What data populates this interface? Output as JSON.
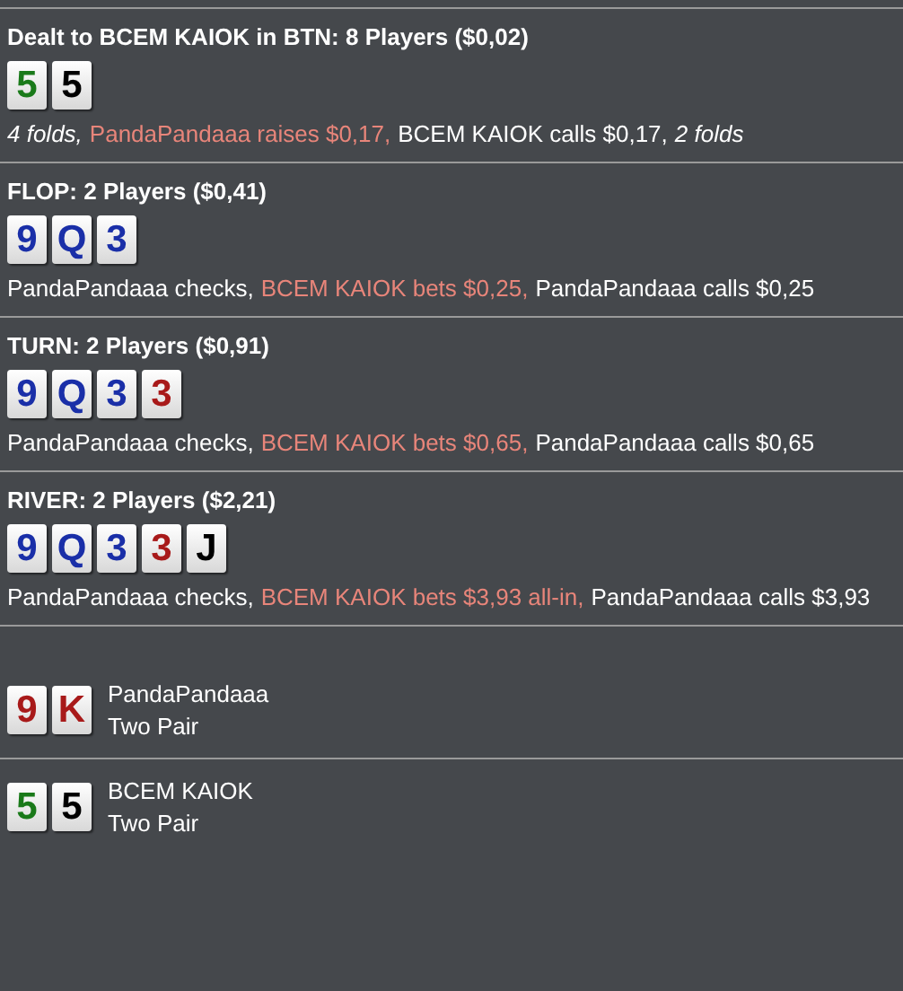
{
  "streets": [
    {
      "title": "Dealt to BCEM KAIOK in BTN: 8 Players ($0,02)",
      "cards": [
        {
          "rank": "5",
          "color": "#1a7a1a"
        },
        {
          "rank": "5",
          "color": "#000000"
        }
      ],
      "actions": [
        {
          "kind": "fold",
          "text": "4 folds,"
        },
        {
          "kind": "highlight",
          "text": "PandaPandaaa raises $0,17,"
        },
        {
          "kind": "plain",
          "text": "BCEM KAIOK calls $0,17,"
        },
        {
          "kind": "fold",
          "text": "2 folds"
        }
      ]
    },
    {
      "title": "FLOP: 2 Players ($0,41)",
      "cards": [
        {
          "rank": "9",
          "color": "#1a2fa8"
        },
        {
          "rank": "Q",
          "color": "#1a2fa8"
        },
        {
          "rank": "3",
          "color": "#1a2fa8"
        }
      ],
      "actions": [
        {
          "kind": "plain",
          "text": "PandaPandaaa checks,"
        },
        {
          "kind": "highlight",
          "text": "BCEM KAIOK bets $0,25,"
        },
        {
          "kind": "plain",
          "text": "PandaPandaaa calls $0,25"
        }
      ]
    },
    {
      "title": "TURN: 2 Players ($0,91)",
      "cards": [
        {
          "rank": "9",
          "color": "#1a2fa8"
        },
        {
          "rank": "Q",
          "color": "#1a2fa8"
        },
        {
          "rank": "3",
          "color": "#1a2fa8"
        },
        {
          "rank": "3",
          "color": "#a81a1a"
        }
      ],
      "actions": [
        {
          "kind": "plain",
          "text": "PandaPandaaa checks,"
        },
        {
          "kind": "highlight",
          "text": "BCEM KAIOK bets $0,65,"
        },
        {
          "kind": "plain",
          "text": "PandaPandaaa calls $0,65"
        }
      ]
    },
    {
      "title": "RIVER: 2 Players ($2,21)",
      "cards": [
        {
          "rank": "9",
          "color": "#1a2fa8"
        },
        {
          "rank": "Q",
          "color": "#1a2fa8"
        },
        {
          "rank": "3",
          "color": "#1a2fa8"
        },
        {
          "rank": "3",
          "color": "#a81a1a"
        },
        {
          "rank": "J",
          "color": "#000000"
        }
      ],
      "actions": [
        {
          "kind": "plain",
          "text": "PandaPandaaa checks,"
        },
        {
          "kind": "highlight",
          "text": "BCEM KAIOK bets $3,93 all-in,"
        },
        {
          "kind": "plain",
          "text": "PandaPandaaa calls $3,93"
        }
      ]
    }
  ],
  "showdown": [
    {
      "player": "PandaPandaaa",
      "hand": "Two Pair",
      "cards": [
        {
          "rank": "9",
          "color": "#a81a1a"
        },
        {
          "rank": "K",
          "color": "#a81a1a"
        }
      ]
    },
    {
      "player": "BCEM KAIOK",
      "hand": "Two Pair",
      "cards": [
        {
          "rank": "5",
          "color": "#1a7a1a"
        },
        {
          "rank": "5",
          "color": "#000000"
        }
      ]
    }
  ]
}
